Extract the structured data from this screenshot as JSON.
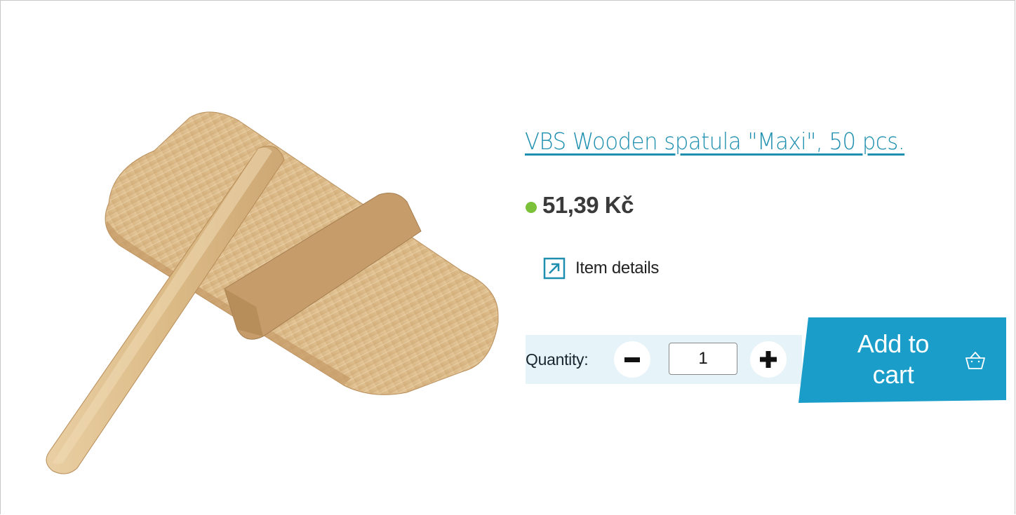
{
  "product": {
    "title": "VBS Wooden spatula \"Maxi\", 50 pcs.",
    "price": "51,39 Kč",
    "stock_color": "#7cc13a",
    "details_label": "Item details",
    "details_icon": "external-link-icon"
  },
  "quantity": {
    "label": "Quantity:",
    "value": "1",
    "minus_icon": "minus-icon",
    "plus_icon": "plus-icon"
  },
  "cart": {
    "label_line1": "Add to",
    "label_line2": "cart",
    "icon": "basket-icon",
    "color": "#1a9dc9"
  },
  "colors": {
    "accent": "#1f8fb0",
    "qty_panel": "#e6f4f9"
  }
}
